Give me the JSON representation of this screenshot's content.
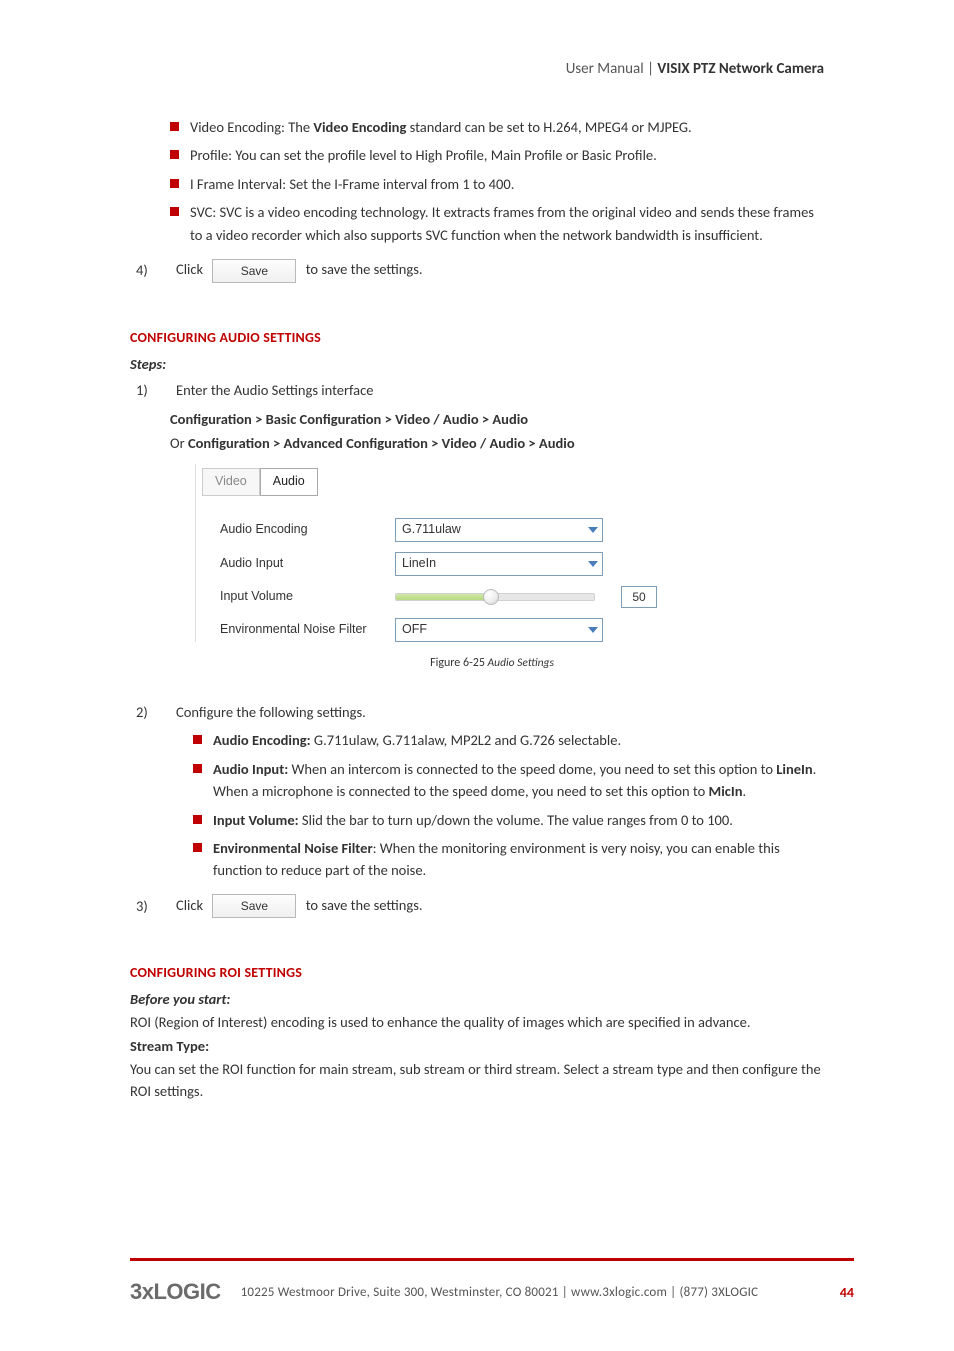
{
  "header": {
    "user_manual": "User Manual",
    "separator": " | ",
    "product": "VISIX PTZ Network Camera"
  },
  "top_bullets": [
    {
      "prefix": "Video Encoding:",
      "before": "   The ",
      "bold": "Video Encoding",
      "after": " standard can be set to H.264, MPEG4 or MJPEG."
    },
    {
      "prefix": "Profile:",
      "before": "   You can set the profile level to High Profile, Main Profile or Basic Profile."
    },
    {
      "prefix": "I Frame Interval:",
      "before": "   Set the I-Frame interval from 1 to 400."
    },
    {
      "prefix": "SVC:",
      "before": "   SVC is a video encoding technology. It extracts frames from the original video and sends these frames to a video recorder which also supports SVC function when the network bandwidth is insufficient."
    }
  ],
  "step4": {
    "num": "4)",
    "pre": "Click",
    "btn": "Save",
    "post": " to save the settings."
  },
  "audio_section": {
    "title": "CONFIGURING AUDIO SETTINGS",
    "steps_label": "Steps:",
    "step1": {
      "num": "1)",
      "text": "Enter the Audio Settings interface"
    },
    "path1": "Configuration > Basic Configuration > Video / Audio > Audio",
    "or": "Or ",
    "path2": "Configuration > Advanced Configuration > Video / Audio > Audio",
    "tabs": {
      "video": "Video",
      "audio": "Audio"
    },
    "rows": {
      "enc_label": "Audio Encoding",
      "enc_val": "G.711ulaw",
      "input_label": "Audio Input",
      "input_val": "LineIn",
      "vol_label": "Input Volume",
      "vol_val": "50",
      "noise_label": "Environmental Noise Filter",
      "noise_val": "OFF"
    },
    "figure": {
      "num": "Figure 6-25",
      "title": " Audio Settings"
    },
    "step2": {
      "num": "2)",
      "text": "Configure the following settings."
    },
    "step2_bullets": [
      {
        "bold": "Audio Encoding:",
        "rest": " G.711ulaw, G.711alaw, MP2L2 and G.726 selectable."
      },
      {
        "bold": "Audio Input:",
        "rest_a": " When an intercom is connected to the speed dome, you need to set this option to ",
        "b1": "LineIn",
        "rest_b": ". When a microphone is connected to the speed dome, you need to set this option to ",
        "b2": "MicIn",
        "rest_c": "."
      },
      {
        "bold": "Input Volume:",
        "rest": " Slid the bar to turn up/down the volume. The value ranges from 0 to 100."
      },
      {
        "bold": "Environmental Noise Filter",
        "rest": ": When the monitoring environment is very noisy, you can enable this function to reduce part of the noise."
      }
    ],
    "step3": {
      "num": "3)",
      "pre": "Click",
      "btn": "Save",
      "post": " to save the settings."
    }
  },
  "roi_section": {
    "title": "CONFIGURING ROI SETTINGS",
    "before": "Before you start:",
    "para1": "ROI (Region of Interest) encoding is used to enhance the quality of images which are specified in advance.",
    "stream_label": "Stream Type:",
    "para2": "You can set the ROI function for main stream, sub stream or third stream. Select a stream type and then configure the ROI settings."
  },
  "footer": {
    "logo": "3xLOGIC",
    "text": "10225 Westmoor Drive, Suite 300, Westminster, CO 80021 | www.3xlogic.com | (877) 3XLOGIC",
    "page": "44"
  }
}
